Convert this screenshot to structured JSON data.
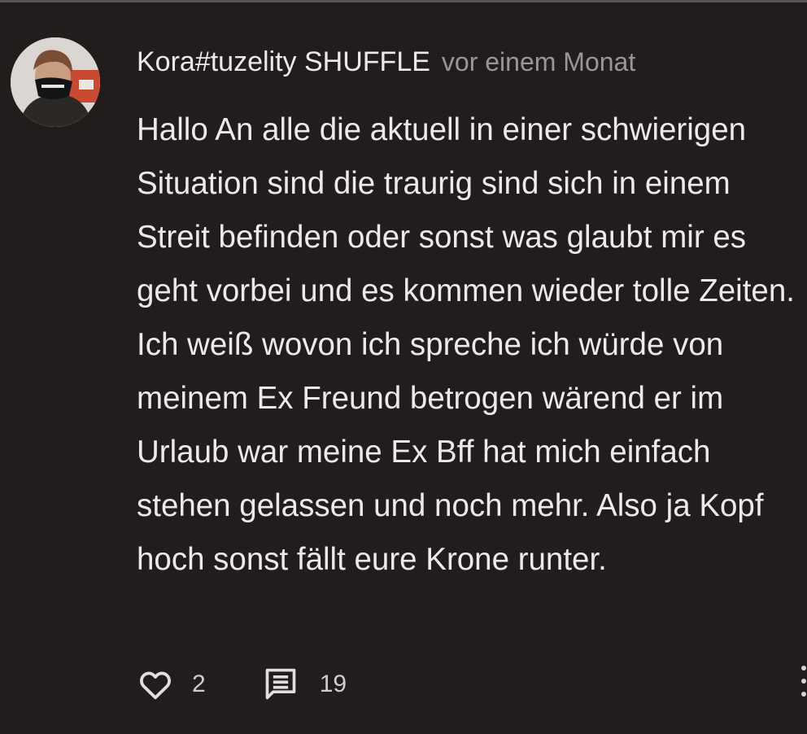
{
  "comment": {
    "author": "Kora#tuzelity SHUFFLE",
    "time": "vor einem Monat",
    "text": "Hallo An alle die aktuell in einer schwierigen Situation sind die traurig sind sich in einem Streit befinden oder sonst was glaubt mir es geht vorbei und es kommen wieder tolle Zeiten. Ich weiß wovon ich spreche ich würde von meinem Ex Freund betrogen wärend er im Urlaub war meine Ex Bff hat mich einfach stehen gelassen und noch mehr. Also ja Kopf hoch sonst fällt eure Krone runter.",
    "likes": "2",
    "replies": "19"
  },
  "icons": {
    "like": "heart-outline-icon",
    "reply": "comment-bubble-icon",
    "more": "more-vertical-icon"
  },
  "colors": {
    "background": "#221c1c",
    "text": "#efe8e8",
    "muted": "#9c9595"
  }
}
